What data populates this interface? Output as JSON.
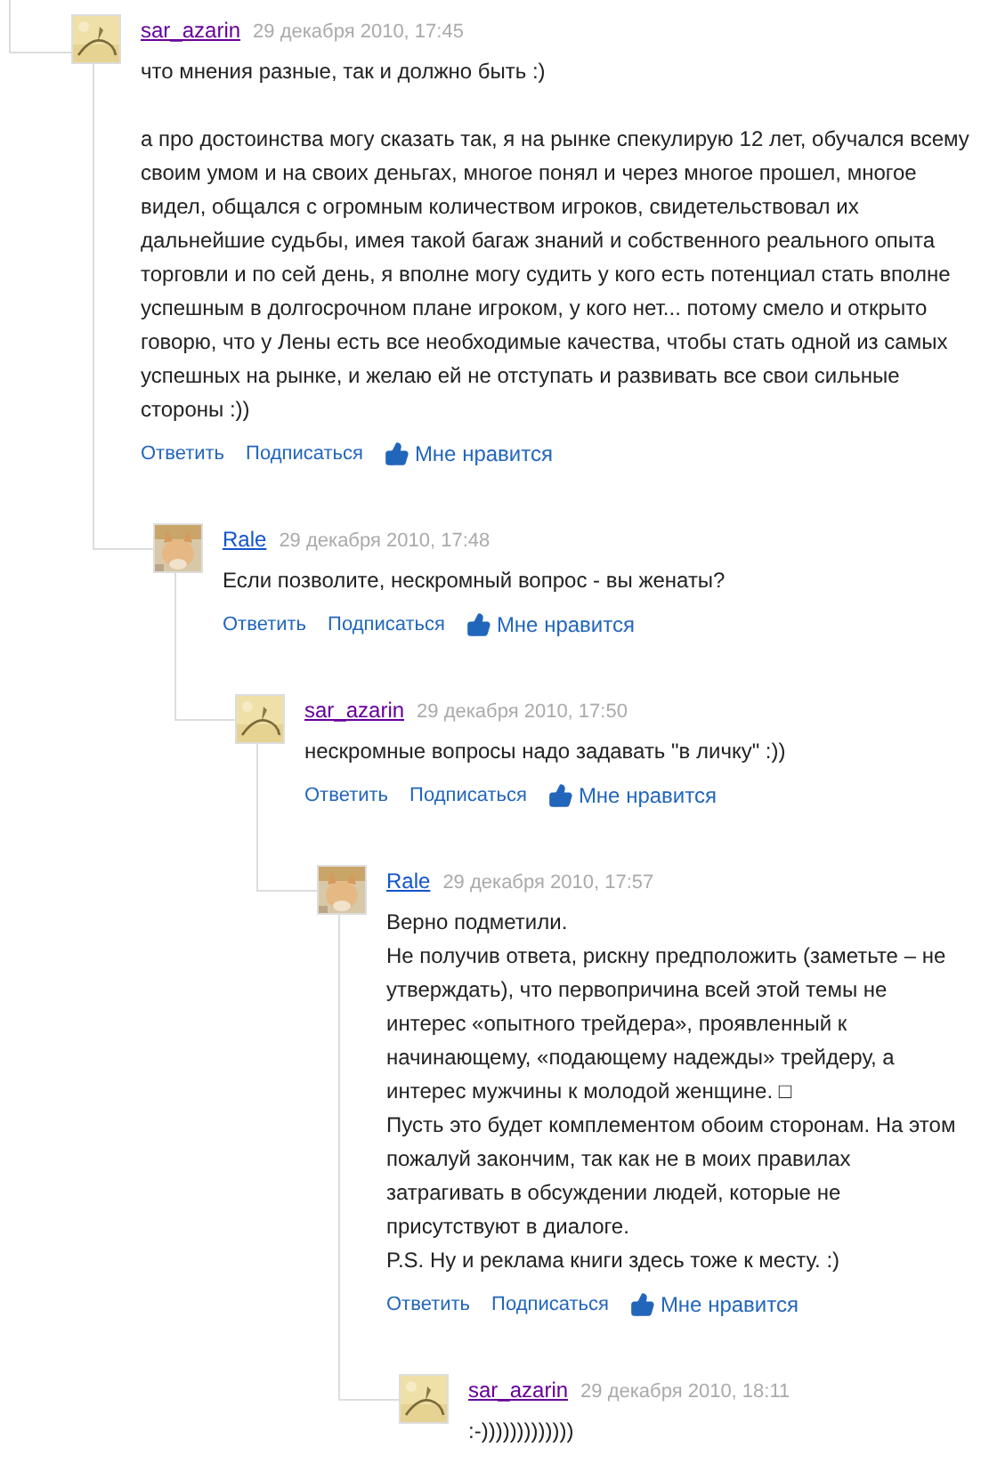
{
  "comments": [
    {
      "author": "sar_azarin",
      "visited": true,
      "date": "29 декабря 2010, 17:45",
      "paragraphs": [
        {
          "text": "что мнения разные, так и должно быть :)",
          "space_before": false
        },
        {
          "text": "а про достоинства могу сказать так, я на рынке спекулирую 12 лет, обучался всему своим умом и на своих деньгах, многое понял и через многое прошел, многое видел, общался с огромным количеством игроков, свидетельствовал их дальнейшие судьбы, имея такой багаж знаний и собственного реального опыта торговли и по сей день, я вполне могу судить у кого есть потенциал стать вполне успешным в долгосрочном плане игроком, у кого нет... потому смело и открыто говорю, что у Лены есть все необходимые качества, чтобы стать одной из самых успешных на рынке, и желаю ей не отступать и развивать все свои сильные стороны :))",
          "space_before": true
        }
      ],
      "actions": [
        "Ответить",
        "Подписаться",
        "Мне нравится"
      ],
      "children": [
        {
          "author": "Rale",
          "visited": false,
          "date": "29 декабря 2010, 17:48",
          "paragraphs": [
            {
              "text": "Если позволите, нескромный вопрос - вы женаты?",
              "space_before": false
            }
          ],
          "actions": [
            "Ответить",
            "Подписаться",
            "Мне нравится"
          ],
          "children": [
            {
              "author": "sar_azarin",
              "visited": true,
              "date": "29 декабря 2010, 17:50",
              "paragraphs": [
                {
                  "text": "нескромные вопросы надо задавать \"в личку\" :))",
                  "space_before": false
                }
              ],
              "actions": [
                "Ответить",
                "Подписаться",
                "Мне нравится"
              ],
              "children": [
                {
                  "author": "Rale",
                  "visited": false,
                  "date": "29 декабря 2010, 17:57",
                  "paragraphs": [
                    {
                      "text": "Верно подметили.",
                      "space_before": false
                    },
                    {
                      "text": "Не получив ответа, рискну предположить (заметьте – не утверждать), что первопричина всей этой темы не интерес «опытного трейдера», проявленный к начинающему, «подающему надежды» трейдеру, а интерес мужчины к молодой женщине. □",
                      "space_before": false
                    },
                    {
                      "text": "Пусть это будет комплементом обоим сторонам. На этом пожалуй закончим, так как не в моих правилах затрагивать в обсуждении людей, которые не присутствуют в диалоге.",
                      "space_before": false
                    },
                    {
                      "text": "P.S. Ну и реклама книги здесь тоже к месту. :)",
                      "space_before": false
                    }
                  ],
                  "actions": [
                    "Ответить",
                    "Подписаться",
                    "Мне нравится"
                  ],
                  "children": [
                    {
                      "author": "sar_azarin",
                      "visited": true,
                      "date": "29 декабря 2010, 18:11",
                      "paragraphs": [
                        {
                          "text": ":-)))))))))))))",
                          "space_before": false
                        }
                      ]
                    }
                  ]
                }
              ]
            }
          ]
        }
      ]
    }
  ]
}
